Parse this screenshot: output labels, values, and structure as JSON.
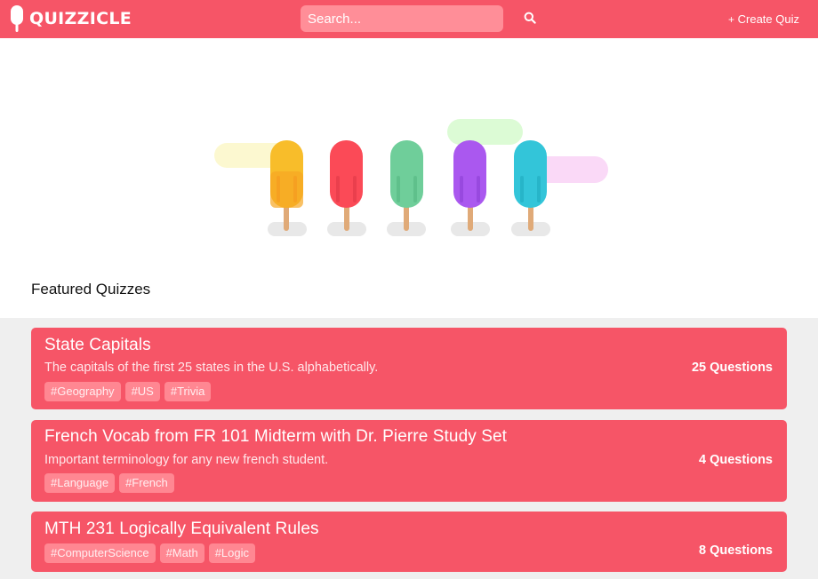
{
  "header": {
    "brand": "QUIZZICLE",
    "search_placeholder": "Search...",
    "search_button": "search",
    "create_plus": "+",
    "create_label": "Create Quiz"
  },
  "hero": {
    "popsicle_colors": [
      "#f8bd2a",
      "#fb4a57",
      "#6fce9a",
      "#aa58ef",
      "#33c5d9"
    ]
  },
  "featured": {
    "title": "Featured Quizzes"
  },
  "quizzes": [
    {
      "title": "State Capitals",
      "description": "The capitals of the first 25 states in the U.S. alphabetically.",
      "count": "25 Questions",
      "tags": [
        "#Geography",
        "#US",
        "#Trivia"
      ]
    },
    {
      "title": "French Vocab from FR 101 Midterm with Dr. Pierre Study Set",
      "description": "Important terminology for any new french student.",
      "count": "4 Questions",
      "tags": [
        "#Language",
        "#French"
      ]
    },
    {
      "title": "MTH 231 Logically Equivalent Rules",
      "description": "",
      "count": "8 Questions",
      "tags": [
        "#ComputerScience",
        "#Math",
        "#Logic"
      ]
    }
  ],
  "colors": {
    "brand": "#f65567",
    "list_background": "#efefef",
    "tag_background": "#ff8792"
  }
}
